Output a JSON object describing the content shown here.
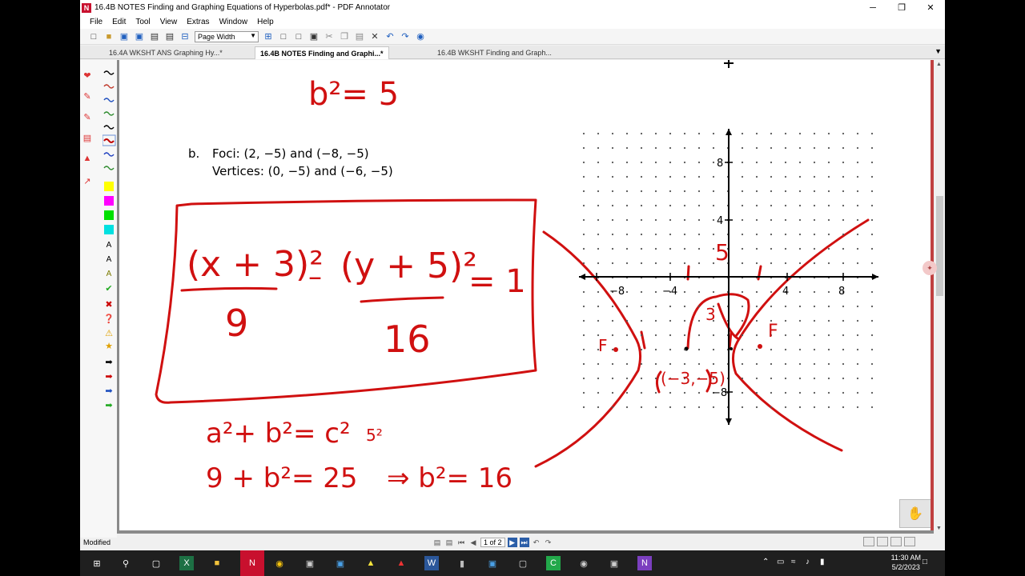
{
  "window": {
    "title": "16.4B NOTES Finding and Graphing Equations of Hyperbolas.pdf* - PDF Annotator",
    "app_icon": "N",
    "minimize": "─",
    "maximize": "❐",
    "close": "✕"
  },
  "menu": [
    "File",
    "Edit",
    "Tool",
    "View",
    "Extras",
    "Window",
    "Help"
  ],
  "toolbar": {
    "zoom_value": "Page Width"
  },
  "tabs": [
    {
      "label": "16.4A WKSHT ANS Graphing Hy...*",
      "active": false
    },
    {
      "label": "16.4B NOTES Finding and Graphi...*",
      "active": true
    },
    {
      "label": "16.4B WKSHT Finding and Graph...",
      "active": false
    }
  ],
  "sidebar": {
    "pen_colors": [
      "#000000",
      "#c0392b",
      "#1f4fbf",
      "#2e8b2e",
      "#000000",
      "#c00000",
      "#1f3fbf",
      "#2e8b2e"
    ],
    "highlighter_colors": [
      "#ffff00",
      "#ff00ff",
      "#00e000",
      "#00e0e0"
    ]
  },
  "document": {
    "handwritten_top": "b²= 5",
    "problem_label": "b.",
    "foci_line": "Foci:  (2, −5) and (−8, −5)",
    "vertices_line": "Vertices:  (0, −5) and (−6, −5)",
    "equation": {
      "num1": "(x + 3)²",
      "den1": "9",
      "minus": "–",
      "num2": "(y + 5)²",
      "den2": "16",
      "rhs": "= 1"
    },
    "work_line1": "a²+ b²= c²",
    "work_note": "5²",
    "work_line2": "9 + b²= 25",
    "work_result": "⇒  b²= 16",
    "graph": {
      "tick_labels_x": [
        "−8",
        "−4",
        "4",
        "8"
      ],
      "tick_labels_y": [
        "8",
        "4",
        "−8"
      ],
      "annot_5": "5",
      "annot_3": "3",
      "focus_label_left": "F",
      "focus_label_right": "F",
      "center_label": "(−3,−5)"
    }
  },
  "navigation": {
    "page_indicator": "1 of 2"
  },
  "status": {
    "text": "Modified"
  },
  "taskbar": {
    "time": "11:30 AM",
    "date": "5/2/2023"
  }
}
